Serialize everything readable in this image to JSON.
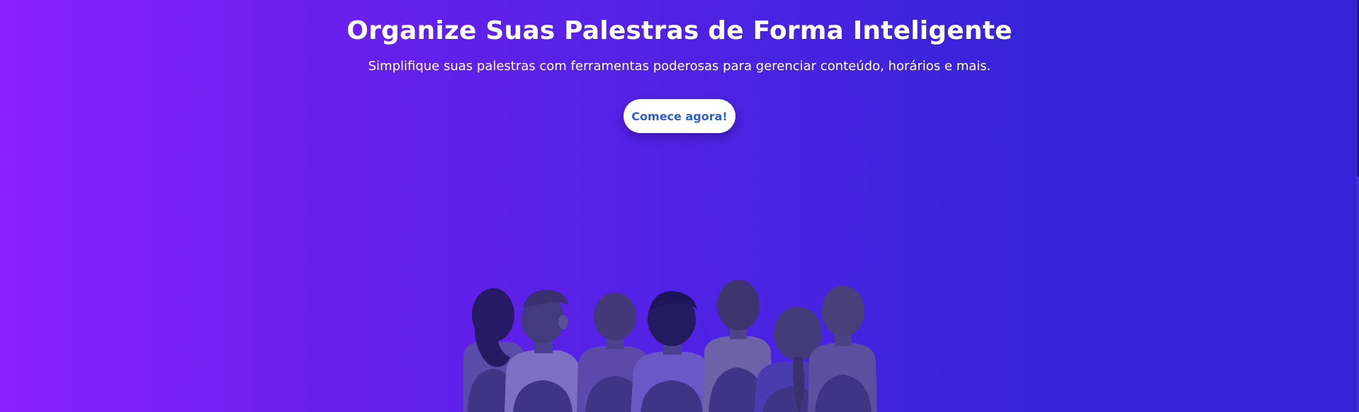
{
  "hero": {
    "title": "Organize Suas Palestras de Forma Inteligente",
    "subtitle": "Simplifique suas palestras com ferramentas poderosas para gerenciar conteúdo, horários e mais.",
    "cta_label": "Comece agora!"
  },
  "illustration": {
    "icon": "audience-illustration"
  },
  "colors": {
    "gradient_start": "#8a20ff",
    "gradient_end": "#3423d6",
    "button_bg": "#ffffff",
    "button_text": "#2b5fd1"
  }
}
